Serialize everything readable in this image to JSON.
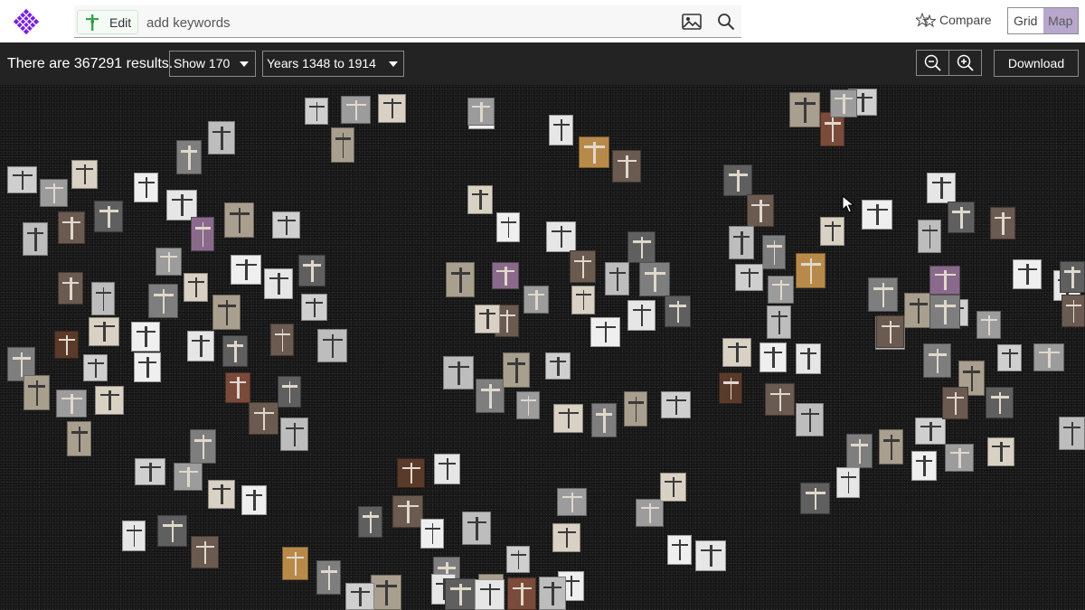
{
  "search": {
    "edit_label": "Edit",
    "placeholder": "add keywords"
  },
  "header": {
    "compare_label": "Compare",
    "view_options": [
      "Grid",
      "Map"
    ],
    "active_view": "Map"
  },
  "toolbar": {
    "results_text": "There are 367291 results.",
    "show_label": "Show 170",
    "years_label": "Years 1348 to 1914",
    "download_label": "Download"
  },
  "colors": {
    "brand": "#8a2be2",
    "map_active": "#b7a7cc",
    "toolbar_bg": "#232323"
  },
  "icons": [
    "logo-icon",
    "edit-thumbnail-icon",
    "image-search-icon",
    "search-icon",
    "compare-stars-icon",
    "zoom-out-icon",
    "zoom-in-icon",
    "caret-down-icon",
    "mouse-cursor-icon"
  ]
}
